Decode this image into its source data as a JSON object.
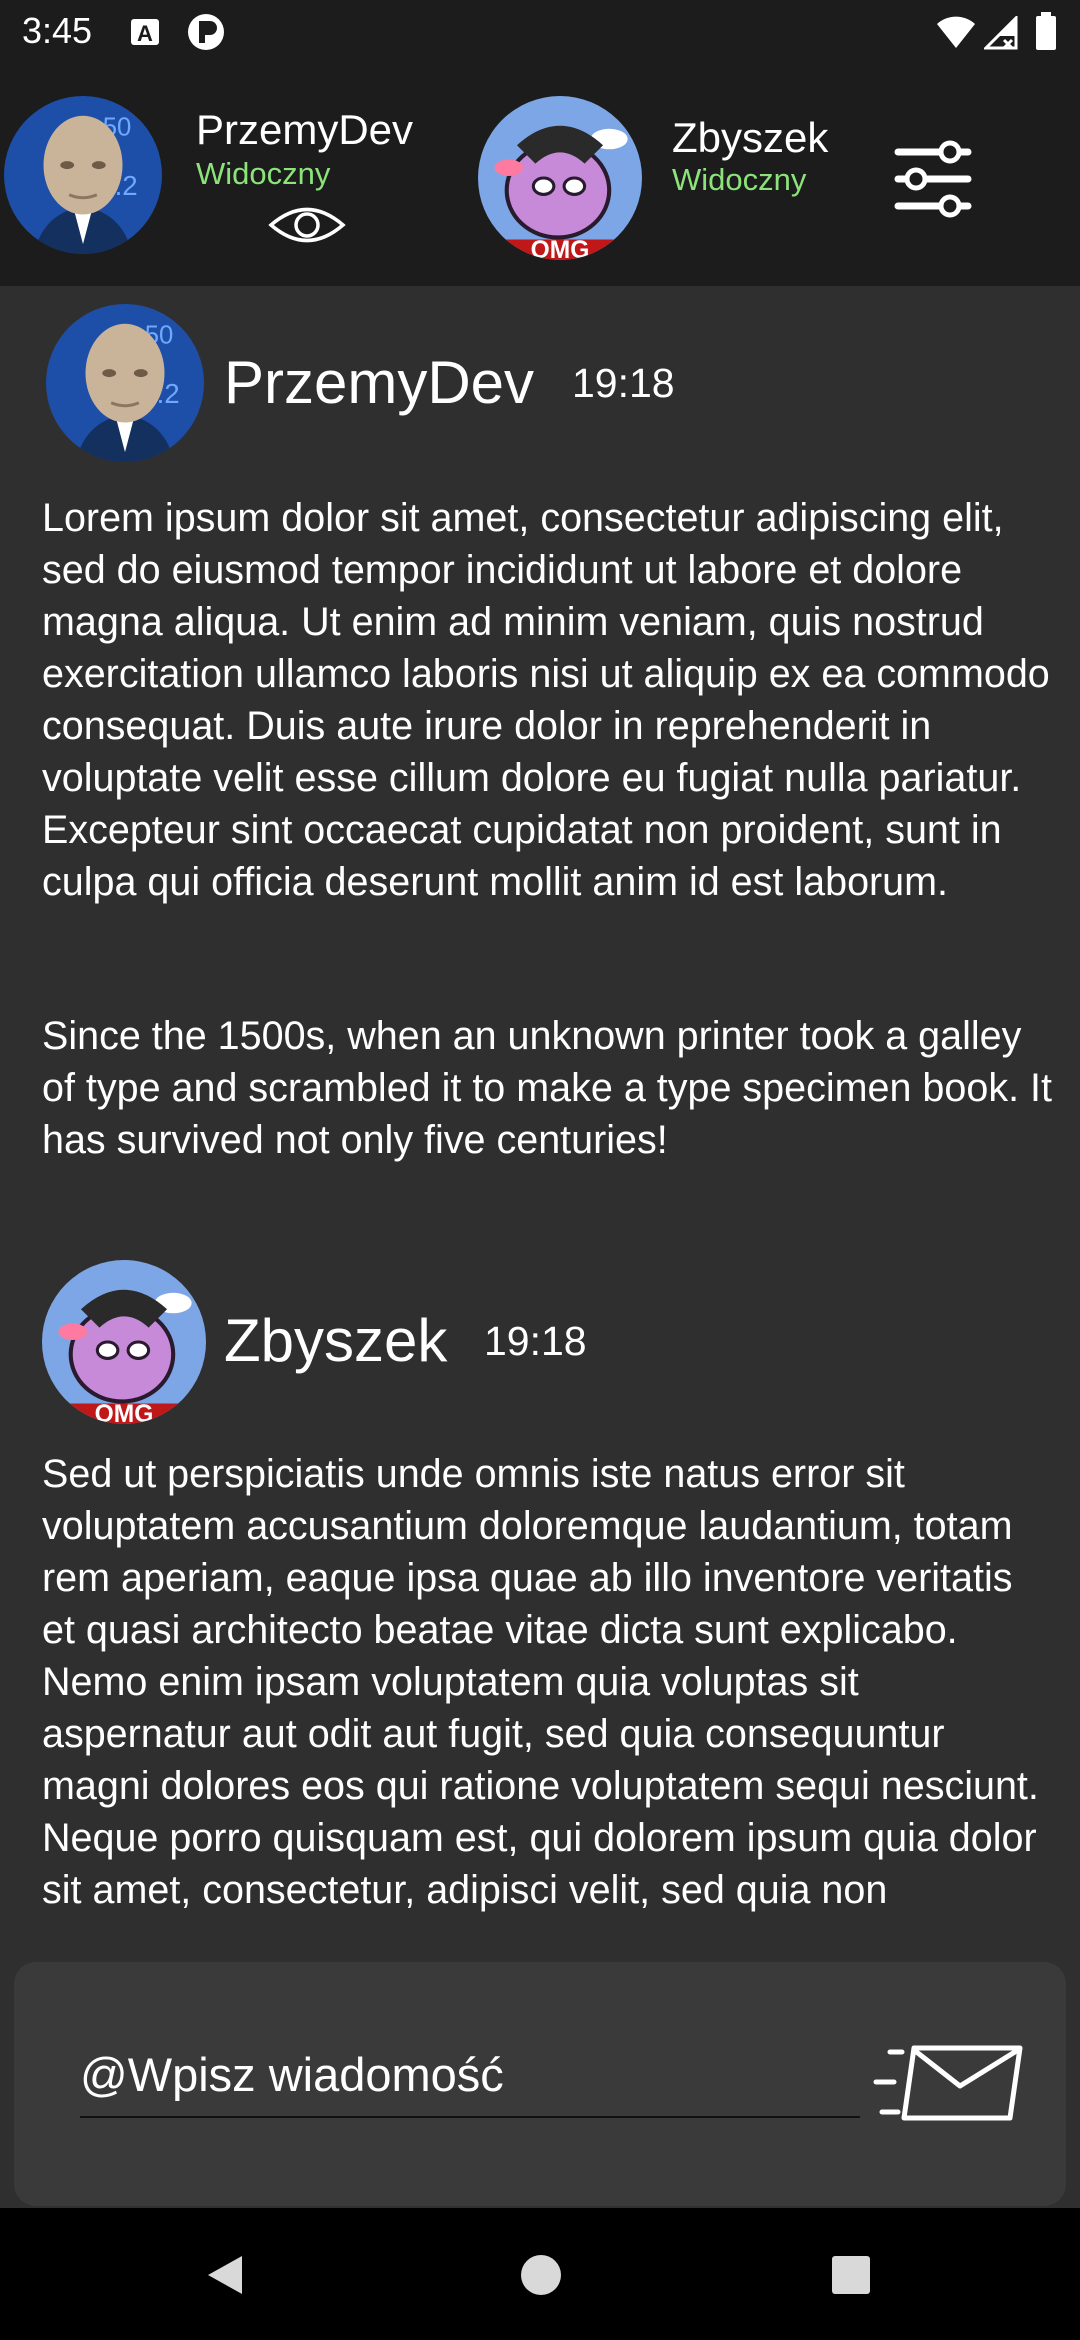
{
  "status_bar": {
    "time": "3:45",
    "icons": [
      "notification-a-icon",
      "app-status-icon",
      "wifi-icon",
      "signal-icon",
      "battery-icon"
    ]
  },
  "header": {
    "contact_1": {
      "name": "PrzemyDev",
      "status": "Widoczny",
      "avatar": "meme-man-avatar"
    },
    "contact_2": {
      "name": "Zbyszek",
      "status": "Widoczny",
      "avatar": "purple-monster-avatar"
    },
    "visibility_icon": "eye-icon",
    "settings_icon": "sliders-icon",
    "status_color": "#8be37a"
  },
  "messages": [
    {
      "author": "PrzemyDev",
      "time": "19:18",
      "avatar": "meme-man-avatar",
      "paragraphs": [
        "Lorem ipsum dolor sit amet, consectetur adipiscing elit, sed do eiusmod tempor incididunt ut labore et dolore magna aliqua. Ut enim ad minim veniam, quis nostrud exercitation ullamco laboris nisi ut aliquip ex ea commodo consequat. Duis aute irure dolor in reprehenderit in voluptate velit esse cillum dolore eu fugiat nulla pariatur. Excepteur sint occaecat cupidatat non proident, sunt in culpa qui officia deserunt mollit anim id est laborum.",
        "Since the 1500s, when an unknown printer took a galley of type and scrambled it to make a type specimen book. It has survived not only five centuries!"
      ]
    },
    {
      "author": "Zbyszek",
      "time": "19:18",
      "avatar": "purple-monster-avatar",
      "paragraphs": [
        "Sed ut perspiciatis unde omnis iste natus error sit voluptatem accusantium doloremque laudantium, totam rem aperiam, eaque ipsa quae ab illo inventore veritatis et quasi architecto beatae vitae dicta sunt explicabo. Nemo enim ipsam voluptatem quia voluptas sit aspernatur aut odit aut fugit, sed quia consequuntur magni dolores eos qui ratione voluptatem sequi nesciunt. Neque porro quisquam est, qui dolorem ipsum quia dolor sit amet, consectetur, adipisci velit, sed quia non"
      ]
    }
  ],
  "composer": {
    "placeholder": "@Wpisz wiadomość",
    "send_icon": "send-mail-icon"
  },
  "nav_bar": {
    "buttons": [
      "back-icon",
      "home-icon",
      "recents-icon"
    ]
  }
}
